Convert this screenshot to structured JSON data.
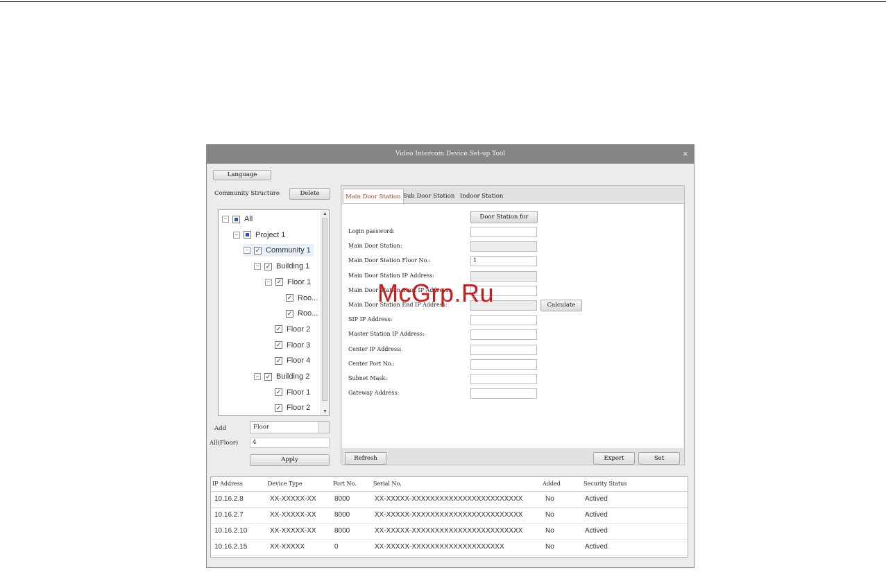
{
  "window": {
    "title": "Video Intercom Device Set-up Tool",
    "close": "×"
  },
  "language_button": "Language",
  "community": {
    "label": "Community Structure",
    "delete_button": "Delete",
    "tree": [
      {
        "label": "All",
        "check": "partial",
        "toggle": "−",
        "level": 0
      },
      {
        "label": "Project 1",
        "check": "partial",
        "toggle": "−",
        "level": 1
      },
      {
        "label": "Community 1",
        "check": "checked",
        "toggle": "−",
        "level": 2,
        "selected": true
      },
      {
        "label": "Building 1",
        "check": "checked",
        "toggle": "−",
        "level": 3
      },
      {
        "label": "Floor 1",
        "check": "checked",
        "toggle": "−",
        "level": 4
      },
      {
        "label": "Roo...",
        "check": "checked",
        "toggle": "",
        "level": 5
      },
      {
        "label": "Roo...",
        "check": "checked",
        "toggle": "",
        "level": 5
      },
      {
        "label": "Floor 2",
        "check": "checked",
        "toggle": "",
        "level": 4
      },
      {
        "label": "Floor 3",
        "check": "checked",
        "toggle": "",
        "level": 4
      },
      {
        "label": "Floor 4",
        "check": "checked",
        "toggle": "",
        "level": 4
      },
      {
        "label": "Building 2",
        "check": "checked",
        "toggle": "−",
        "level": 3
      },
      {
        "label": "Floor 1",
        "check": "checked",
        "toggle": "",
        "level": 4
      },
      {
        "label": "Floor 2",
        "check": "checked",
        "toggle": "",
        "level": 4
      }
    ],
    "add_label": "Add",
    "add_select": "Floor",
    "all_floor_label": "All(Floor)",
    "all_floor_value": "4",
    "apply_button": "Apply"
  },
  "tabs": [
    "Main Door Station",
    "Sub Door Station",
    "Indoor Station"
  ],
  "form": {
    "station_for_button": "Door Station for",
    "calculate_button": "Calculate",
    "fields": [
      {
        "label": "Login password:",
        "value": "",
        "disabled": false
      },
      {
        "label": "Main Door Station:",
        "value": "",
        "disabled": true
      },
      {
        "label": "Main Door Station Floor No.:",
        "value": "1",
        "disabled": false
      },
      {
        "label": "Main Door Station IP Address:",
        "value": "",
        "disabled": true
      },
      {
        "label": "Main Door Station Start IP Address:",
        "value": "",
        "disabled": false
      },
      {
        "label": "Main Door Station End IP Address:",
        "value": "",
        "disabled": true
      },
      {
        "label": "SIP IP Address:",
        "value": "",
        "disabled": false
      },
      {
        "label": "Master Station IP Address:",
        "value": "",
        "disabled": false
      },
      {
        "label": "Center IP Address:",
        "value": "",
        "disabled": false
      },
      {
        "label": "Center Port No.:",
        "value": "",
        "disabled": false
      },
      {
        "label": "Subnet Mask:",
        "value": "",
        "disabled": false
      },
      {
        "label": "Gateway Address:",
        "value": "",
        "disabled": false
      }
    ],
    "refresh_button": "Refresh",
    "export_button": "Export",
    "set_button": "Set"
  },
  "device_table": {
    "columns": [
      "IP Address",
      "Device Type",
      "Port No.",
      "Serial No.",
      "Added",
      "Security Status"
    ],
    "rows": [
      [
        "10.16.2.8",
        "XX-XXXXX-XX",
        "8000",
        "XX-XXXXX-XXXXXXXXXXXXXXXXXXXXXXXX",
        "No",
        "Actived"
      ],
      [
        "10.16.2.7",
        "XX-XXXXX-XX",
        "8000",
        "XX-XXXXX-XXXXXXXXXXXXXXXXXXXXXXXX",
        "No",
        "Actived"
      ],
      [
        "10.16.2.10",
        "XX-XXXXX-XX",
        "8000",
        "XX-XXXXX-XXXXXXXXXXXXXXXXXXXXXXXX",
        "No",
        "Actived"
      ],
      [
        "10.16.2.15",
        "XX-XXXXX",
        "0",
        "XX-XXXXX-XXXXXXXXXXXXXXXXXXXX",
        "No",
        "Actived"
      ]
    ]
  },
  "watermark": "McGrp.Ru",
  "colors": {
    "titlebar": "#858585",
    "active_tab": "#c0392b",
    "watermark": "#d01818",
    "check_partial": "#2255cc"
  }
}
